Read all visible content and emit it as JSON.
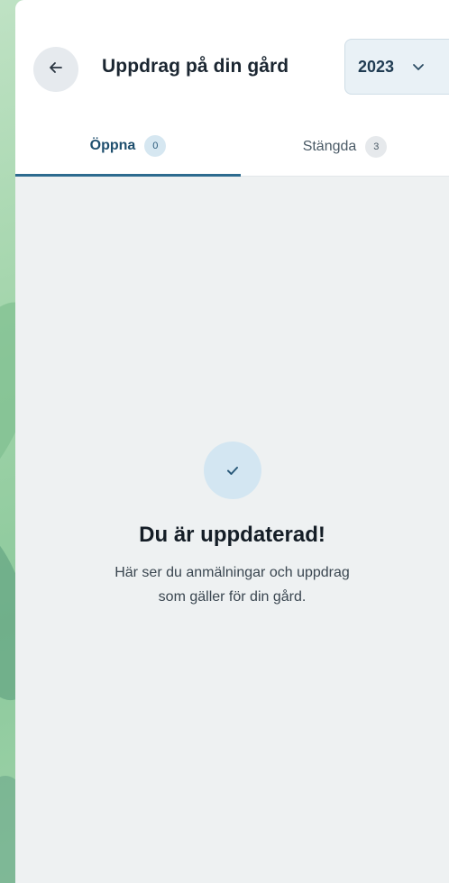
{
  "header": {
    "title": "Uppdrag på din gård",
    "year_select": {
      "value": "2023"
    }
  },
  "tabs": [
    {
      "label": "Öppna",
      "count": "0",
      "active": true
    },
    {
      "label": "Stängda",
      "count": "3",
      "active": false
    }
  ],
  "empty_state": {
    "title": "Du är uppdaterad!",
    "text": "Här ser du anmälningar och uppdrag som gäller för din gård."
  },
  "icons": {
    "back": "arrow-left-icon",
    "dropdown": "chevron-down-icon",
    "status": "check-icon"
  },
  "colors": {
    "accent": "#2d6b8f",
    "panel_background": "#eef1f2",
    "header_background": "#ffffff"
  }
}
